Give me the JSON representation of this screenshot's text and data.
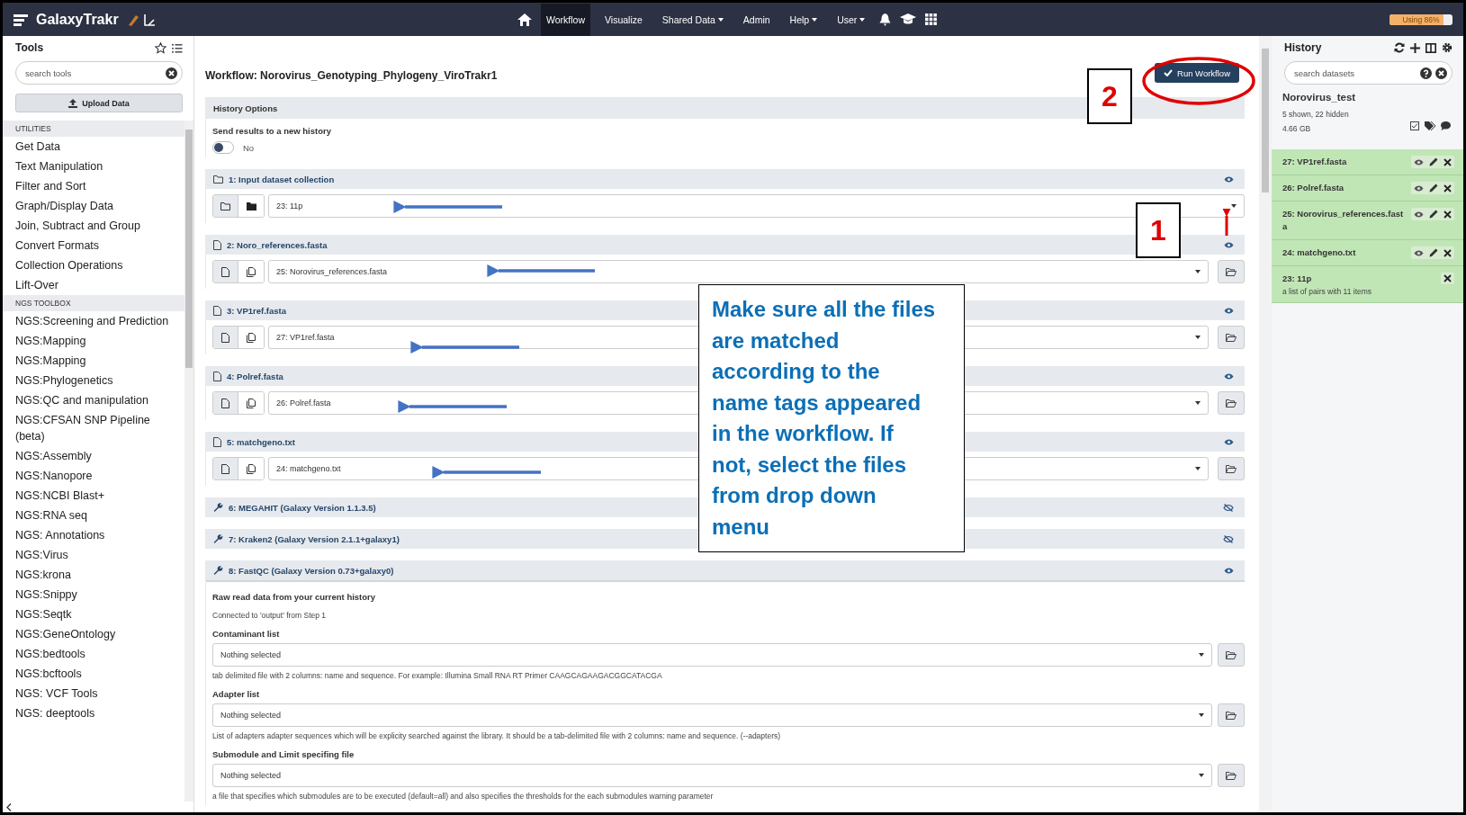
{
  "navbar": {
    "brand": "GalaxyTrakr",
    "items": [
      {
        "label": "Workflow",
        "selected": true,
        "dropdown": false
      },
      {
        "label": "Visualize",
        "selected": false,
        "dropdown": false
      },
      {
        "label": "Shared Data",
        "selected": false,
        "dropdown": true
      },
      {
        "label": "Admin",
        "selected": false,
        "dropdown": false
      },
      {
        "label": "Help",
        "selected": false,
        "dropdown": true
      },
      {
        "label": "User",
        "selected": false,
        "dropdown": true
      }
    ],
    "usage": {
      "label": "Using 86%",
      "level": 0.86
    }
  },
  "tools": {
    "title": "Tools",
    "search": {
      "placeholder": "search tools"
    },
    "upload": "Upload Data",
    "sections": [
      {
        "title": "UTILITIES",
        "items": [
          "Get Data",
          "Text Manipulation",
          "Filter and Sort",
          "Graph/Display Data",
          "Join, Subtract and Group",
          "Convert Formats",
          "Collection Operations",
          "Lift-Over"
        ]
      },
      {
        "title": "NGS TOOLBOX",
        "items": [
          "NGS:Screening and Prediction",
          "NGS:Mapping",
          "NGS:Mapping",
          "NGS:Phylogenetics",
          "NGS:QC and manipulation",
          "NGS:CFSAN SNP Pipeline (beta)",
          "NGS:Assembly",
          "NGS:Nanopore",
          "NGS:NCBI Blast+",
          "NGS:RNA seq",
          "NGS: Annotations",
          "NGS:Virus",
          "NGS:krona",
          "NGS:Snippy",
          "NGS:Seqtk",
          "NGS:GeneOntology",
          "NGS:bedtools",
          "NGS:bcftools",
          "NGS: VCF Tools",
          "NGS: deeptools"
        ]
      }
    ]
  },
  "workflow": {
    "title": "Workflow: Norovirus_Genotyping_Phylogeny_ViroTrakr1",
    "run_button": "Run Workflow",
    "history_options": {
      "title": "History Options",
      "label": "Send results to a new history",
      "toggle": {
        "on": false,
        "label": "No"
      }
    },
    "steps": [
      {
        "kind": "collection",
        "title": "1: Input dataset collection",
        "visible": true,
        "value": "23: 11p"
      },
      {
        "kind": "dataset",
        "title": "2: Noro_references.fasta",
        "visible": true,
        "value": "25: Norovirus_references.fasta"
      },
      {
        "kind": "dataset",
        "title": "3: VP1ref.fasta",
        "visible": true,
        "value": "27: VP1ref.fasta"
      },
      {
        "kind": "dataset",
        "title": "4: Polref.fasta",
        "visible": true,
        "value": "26: Polref.fasta"
      },
      {
        "kind": "dataset",
        "title": "5: matchgeno.txt",
        "visible": true,
        "value": "24: matchgeno.txt"
      },
      {
        "kind": "tool",
        "title": "6: MEGAHIT (Galaxy Version 1.1.3.5)",
        "visible": false,
        "expanded": false
      },
      {
        "kind": "tool",
        "title": "7: Kraken2 (Galaxy Version 2.1.1+galaxy1)",
        "visible": false,
        "expanded": false
      },
      {
        "kind": "tool",
        "title": "8: FastQC (Galaxy Version 0.73+galaxy0)",
        "visible": true,
        "expanded": true,
        "input_label": "Raw read data from your current history",
        "input_note": "Connected to 'output' from Step 1",
        "fields": [
          {
            "label": "Contaminant list",
            "value": "Nothing selected",
            "help": "tab delimited file with 2 columns: name and sequence. For example: Illumina Small RNA RT Primer CAAGCAGAAGACGGCATACGA"
          },
          {
            "label": "Adapter list",
            "value": "Nothing selected",
            "help": "List of adapters adapter sequences which will be explicity searched against the library. It should be a tab-delimited file with 2 columns: name and sequence. (--adapters)"
          },
          {
            "label": "Submodule and Limit specifing file",
            "value": "Nothing selected",
            "help": "a file that specifies which submodules are to be executed (default=all) and also specifies the thresholds for the each submodules warning parameter"
          }
        ]
      }
    ]
  },
  "history": {
    "title": "History",
    "search": {
      "placeholder": "search datasets"
    },
    "name": "Norovirus_test",
    "counts": "5 shown, 22 hidden",
    "size": "4.66 GB",
    "items": [
      {
        "kind": "dataset",
        "title": "27: VP1ref.fasta"
      },
      {
        "kind": "dataset",
        "title": "26: Polref.fasta"
      },
      {
        "kind": "dataset",
        "title": "25: Norovirus_references.fasta"
      },
      {
        "kind": "dataset",
        "title": "24: matchgeno.txt"
      },
      {
        "kind": "collection",
        "title": "23: 11p",
        "note": "a list of pairs with 11 items"
      }
    ]
  },
  "annotations": {
    "callout": "Make sure all the files are matched according to the name tags appeared in the workflow. If not, select the files from drop down menu",
    "markers": [
      "2",
      "1"
    ]
  }
}
